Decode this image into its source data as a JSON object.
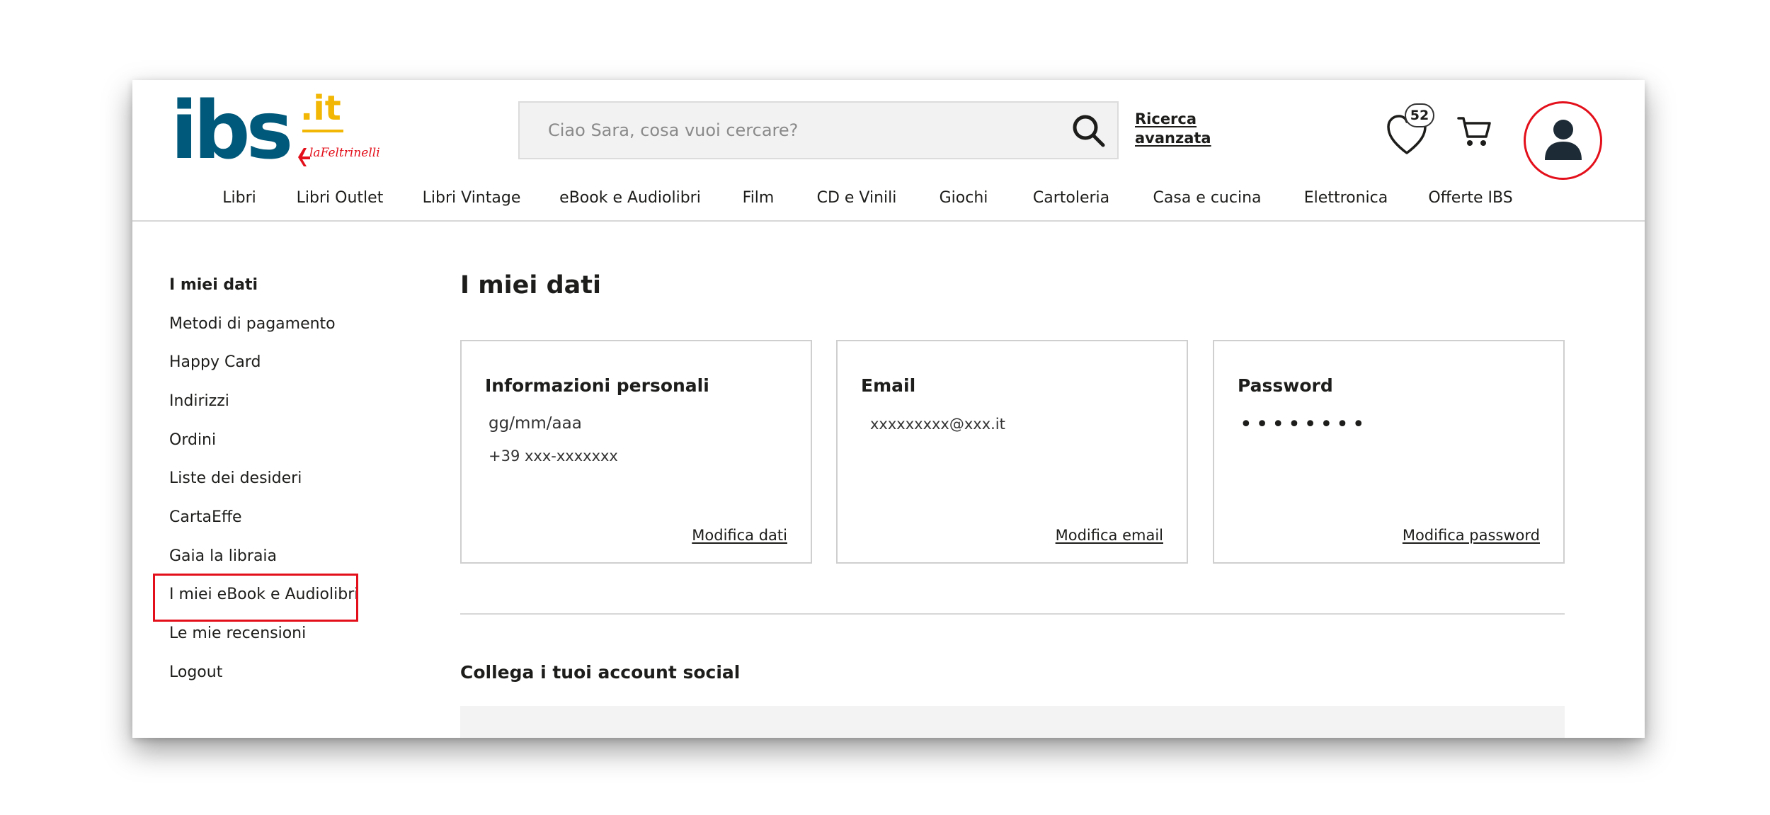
{
  "brand": {
    "logo_text": "ibs",
    "logo_tld": ".it",
    "sub_brand": "laFeltrinelli",
    "colors": {
      "primary": "#00587a",
      "accent": "#f2b705",
      "red": "#e3101b"
    }
  },
  "header": {
    "search_placeholder": "Ciao Sara, cosa vuoi cercare?",
    "search_icon": "search-icon",
    "advanced_search_line1": "Ricerca",
    "advanced_search_line2": "avanzata",
    "wishlist_count": "52",
    "wishlist_icon": "heart-icon",
    "cart_icon": "cart-icon",
    "account_icon": "user-icon"
  },
  "nav": [
    "Libri",
    "Libri Outlet",
    "Libri Vintage",
    "eBook e Audiolibri",
    "Film",
    "CD e Vinili",
    "Giochi",
    "Cartoleria",
    "Casa e cucina",
    "Elettronica",
    "Offerte IBS"
  ],
  "sidebar": [
    "I miei dati",
    "Metodi di pagamento",
    "Happy Card",
    "Indirizzi",
    "Ordini",
    "Liste dei desideri",
    "CartaEffe",
    "Gaia la libraia",
    "I miei eBook e Audiolibri",
    "Le mie recensioni",
    "Logout"
  ],
  "main": {
    "title": "I miei dati",
    "cards": {
      "personal": {
        "title": "Informazioni personali",
        "birthdate": "gg/mm/aaa",
        "phone": "+39 xxx-xxxxxxx",
        "link": "Modifica dati"
      },
      "email": {
        "title": "Email",
        "value": "xxxxxxxxx@xxx.it",
        "link": "Modifica email"
      },
      "password": {
        "title": "Password",
        "value": "••••••••",
        "link": "Modifica password"
      }
    },
    "social_title": "Collega i tuoi account social"
  }
}
